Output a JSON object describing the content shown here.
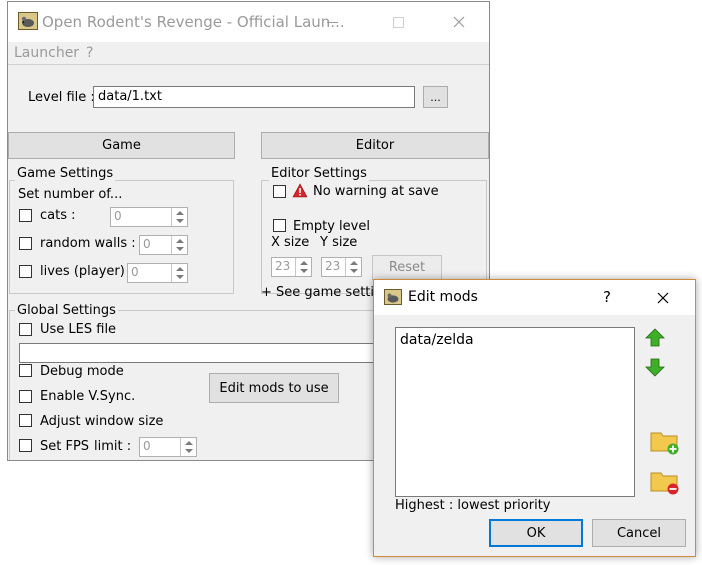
{
  "main_window": {
    "title": "Open Rodent's Revenge - Official Laun...",
    "menu": [
      "Launcher",
      "?"
    ],
    "level_file": {
      "label": "Level file :",
      "value": "data/1.txt",
      "browse_label": "..."
    },
    "tabs": {
      "game": "Game",
      "editor": "Editor"
    },
    "game_settings": {
      "title": "Game Settings",
      "subtitle": "Set number of...",
      "cats": {
        "label": "cats :",
        "value": "0"
      },
      "random_walls": {
        "label": "random walls :",
        "value": "0"
      },
      "lives": {
        "label": "lives (player)",
        "value": "0"
      }
    },
    "editor_settings": {
      "title": "Editor Settings",
      "no_warning": "No warning at save",
      "empty_level": "Empty level",
      "x_size": {
        "label": "X size",
        "value": "23"
      },
      "y_size": {
        "label": "Y size",
        "value": "23"
      },
      "reset": "Reset",
      "see_game_settings": "+ See game setting"
    },
    "global_settings": {
      "title": "Global Settings",
      "use_les": "Use LES file",
      "debug_mode": "Debug mode",
      "vsync": "Enable V.Sync.",
      "adjust_window": "Adjust window size",
      "set_fps": "Set FPS",
      "limit_label": "limit :",
      "fps_value": "0",
      "edit_mods": "Edit mods to use"
    }
  },
  "edit_mods_dialog": {
    "title": "Edit mods",
    "help": "?",
    "mods": [
      "data/zelda"
    ],
    "priority_label": "Highest : lowest priority",
    "ok": "OK",
    "cancel": "Cancel"
  },
  "colors": {
    "dialog_border": "#d08a3c",
    "default_button_border": "#0078d7",
    "arrow_green": "#3fae29",
    "folder_yellow": "#f2c94c",
    "warning_red": "#d9242b"
  }
}
